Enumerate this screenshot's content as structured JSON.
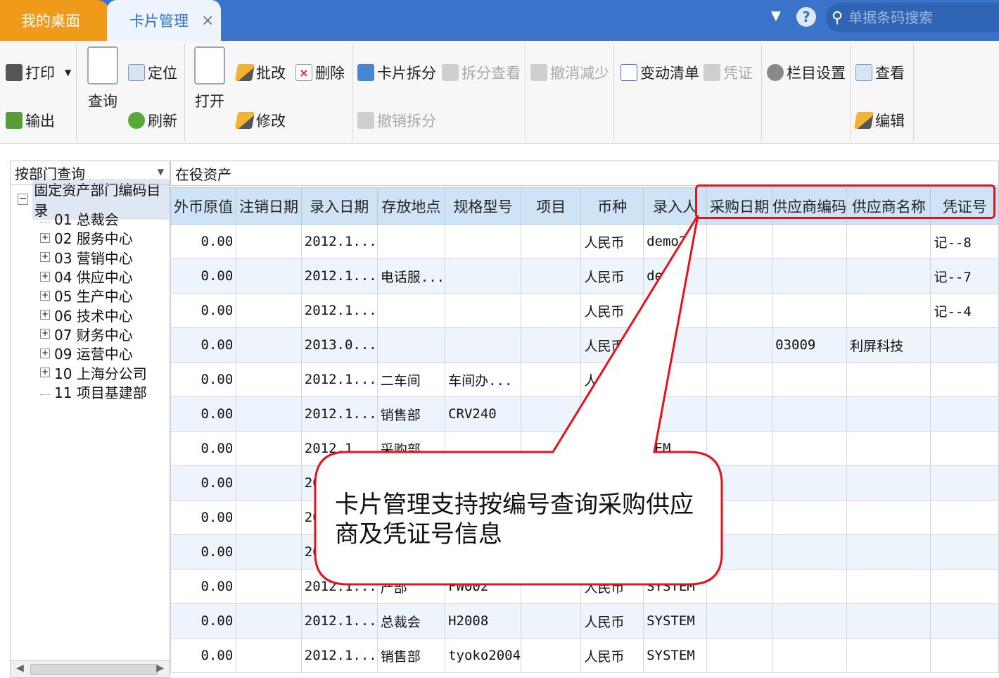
{
  "tabs": {
    "desktop_label": "我的桌面",
    "card_label": "卡片管理",
    "close_glyph": "×"
  },
  "header": {
    "help_glyph": "?",
    "search_placeholder": "单据条码搜索"
  },
  "toolbar": {
    "print": "打印",
    "export": "输出",
    "query": "查询",
    "locate": "定位",
    "refresh": "刷新",
    "open": "打开",
    "batch_edit": "批改",
    "delete": "删除",
    "modify": "修改",
    "card_split": "卡片拆分",
    "split_view": "拆分查看",
    "undo_split": "撤销拆分",
    "undo_reduce": "撤消减少",
    "change_list": "变动清单",
    "voucher": "凭证",
    "column_settings": "栏目设置",
    "view": "查看",
    "edit": "编辑"
  },
  "left_panel": {
    "query_mode": "按部门查询",
    "tree_root": "固定资产部门编码目录",
    "departments": [
      {
        "label": "01 总裁会",
        "expandable": false
      },
      {
        "label": "02 服务中心",
        "expandable": true
      },
      {
        "label": "03 营销中心",
        "expandable": true
      },
      {
        "label": "04 供应中心",
        "expandable": true
      },
      {
        "label": "05 生产中心",
        "expandable": true
      },
      {
        "label": "06 技术中心",
        "expandable": true
      },
      {
        "label": "07 财务中心",
        "expandable": true
      },
      {
        "label": "09 运营中心",
        "expandable": true
      },
      {
        "label": "10 上海分公司",
        "expandable": true
      },
      {
        "label": "11 项目基建部",
        "expandable": false
      }
    ]
  },
  "grid": {
    "title": "在役资产",
    "columns": [
      "外币原值",
      "注销日期",
      "录入日期",
      "存放地点",
      "规格型号",
      "项目",
      "币种",
      "录入人",
      "采购日期",
      "供应商编码",
      "供应商名称",
      "凭证号"
    ],
    "rows": [
      [
        "0.00",
        "",
        "2012.1...",
        "",
        "",
        "",
        "人民币",
        "demo2",
        "",
        "",
        "",
        "记--8"
      ],
      [
        "0.00",
        "",
        "2012.1...",
        "电话服...",
        "",
        "",
        "人民币",
        "dem",
        "",
        "",
        "",
        "记--7"
      ],
      [
        "0.00",
        "",
        "2012.1...",
        "",
        "",
        "",
        "人民币",
        "",
        "",
        "",
        "",
        "记--4"
      ],
      [
        "0.00",
        "",
        "2013.0...",
        "",
        "",
        "",
        "人民币",
        "",
        "",
        "03009",
        "利屏科技",
        ""
      ],
      [
        "0.00",
        "",
        "2012.1...",
        "二车间",
        "车间办...",
        "",
        "人民",
        "M",
        "",
        "",
        "",
        ""
      ],
      [
        "0.00",
        "",
        "2012.1...",
        "销售部",
        "CRV240",
        "",
        "",
        "EM",
        "",
        "",
        "",
        ""
      ],
      [
        "0.00",
        "",
        "2012.1",
        "采购部",
        "",
        "",
        "",
        "TEM",
        "",
        "",
        "",
        ""
      ],
      [
        "0.00",
        "",
        "20",
        "",
        "",
        "",
        "",
        "",
        "",
        "",
        "",
        ""
      ],
      [
        "0.00",
        "",
        "20",
        "",
        "",
        "",
        "",
        "",
        "",
        "",
        "",
        ""
      ],
      [
        "0.00",
        "",
        "20",
        "",
        "",
        "",
        "",
        "",
        "",
        "",
        "",
        ""
      ],
      [
        "0.00",
        "",
        "2012.1...",
        "产部",
        "FW002",
        "",
        "人民币",
        "SYSTEM",
        "",
        "",
        "",
        ""
      ],
      [
        "0.00",
        "",
        "2012.1...",
        "总裁会",
        "H2008",
        "",
        "人民币",
        "SYSTEM",
        "",
        "",
        "",
        ""
      ],
      [
        "0.00",
        "",
        "2012.1...",
        "销售部",
        "tyoko2004",
        "",
        "人民币",
        "SYSTEM",
        "",
        "",
        "",
        ""
      ]
    ]
  },
  "annotation": {
    "text": "卡片管理支持按编号查询采购供应商及凭证号信息",
    "border_color": "#e0141d"
  },
  "colors": {
    "tab_bar": "#3a73c9",
    "desktop_tab": "#ef9a1b",
    "header_row": "#cfe3f6",
    "alt_row": "#eef4fb"
  }
}
